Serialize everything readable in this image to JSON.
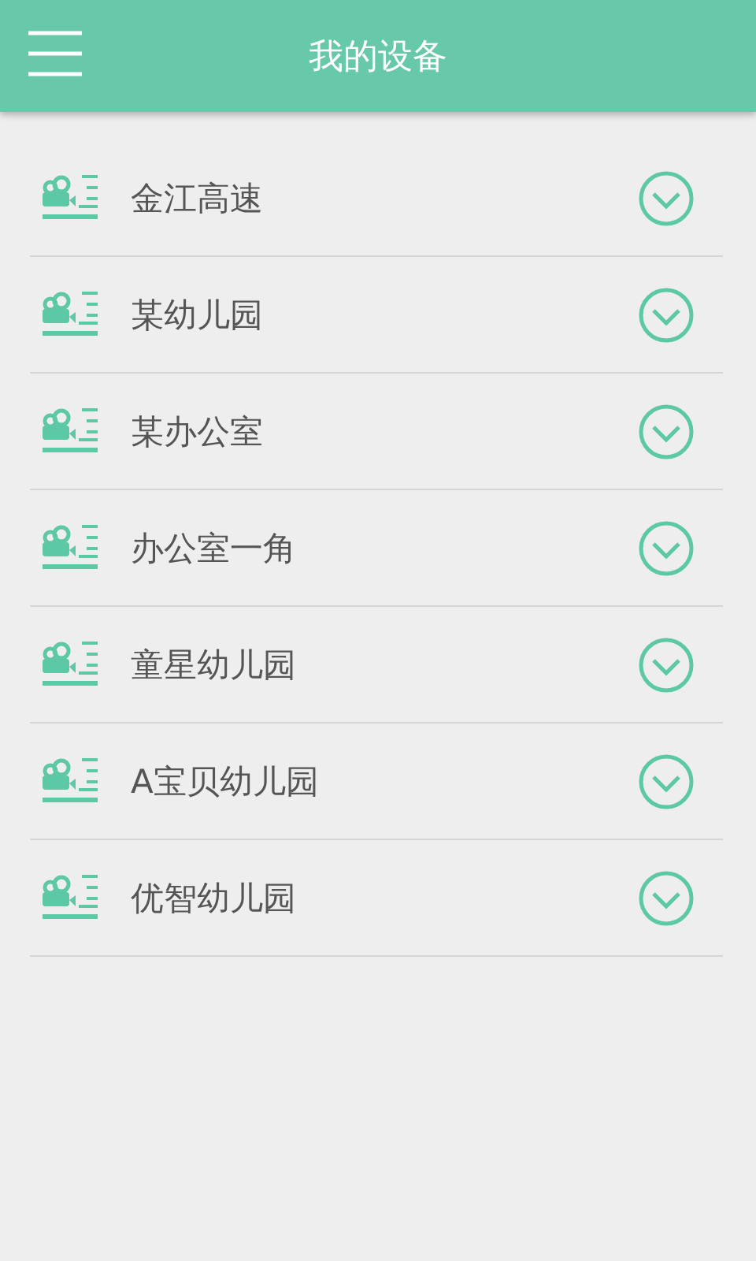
{
  "header": {
    "title": "我的设备"
  },
  "devices": [
    {
      "name": "金江高速"
    },
    {
      "name": "某幼儿园"
    },
    {
      "name": "某办公室"
    },
    {
      "name": "办公室一角"
    },
    {
      "name": "童星幼儿园"
    },
    {
      "name": "A宝贝幼儿园"
    },
    {
      "name": "优智幼儿园"
    }
  ]
}
